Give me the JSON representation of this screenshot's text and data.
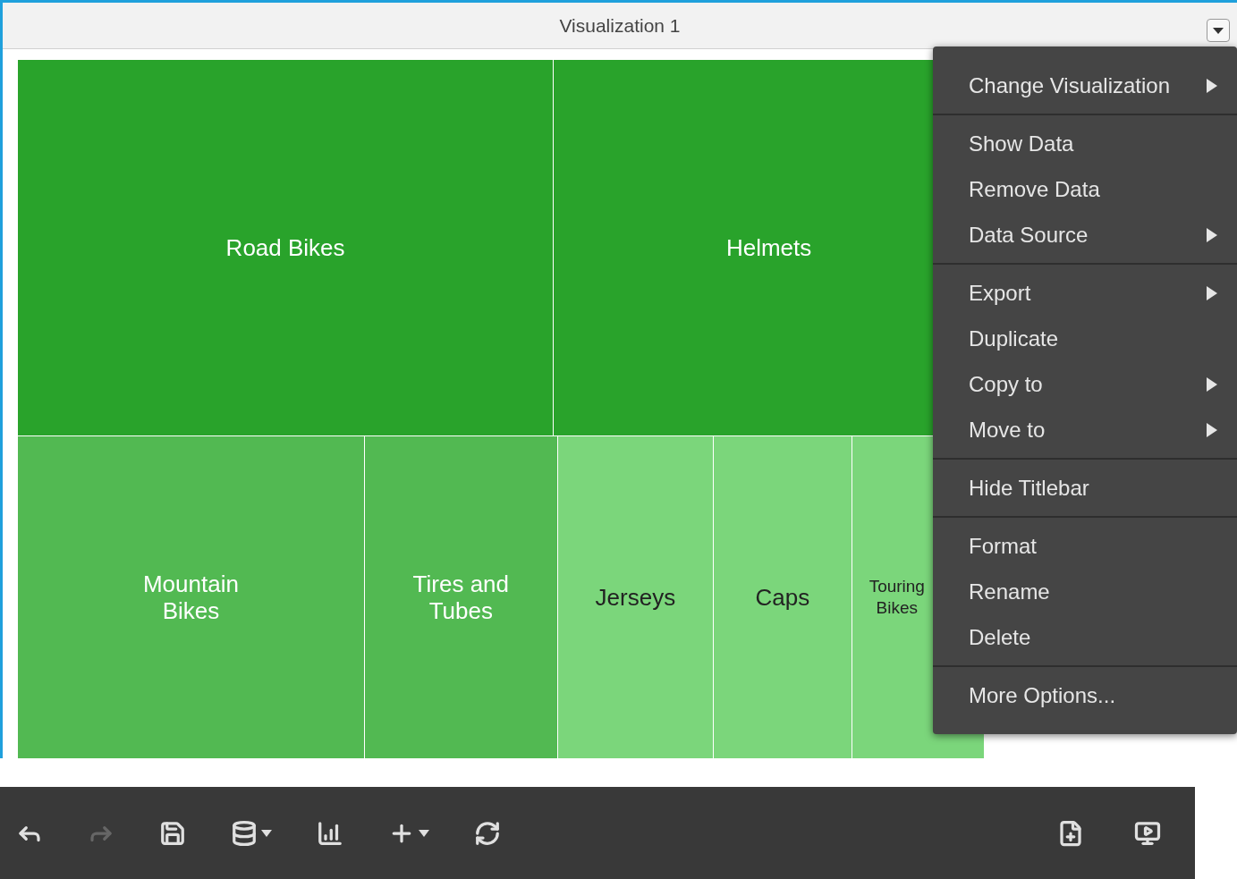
{
  "panel": {
    "title": "Visualization 1"
  },
  "treemap": {
    "cells": [
      {
        "label": "Road Bikes",
        "color": "#29a32b"
      },
      {
        "label": "Helmets",
        "color": "#29a32b"
      },
      {
        "label": "Mountain Bikes",
        "color": "#52b952"
      },
      {
        "label": "Tires and Tubes",
        "color": "#52b952"
      },
      {
        "label": "Jerseys",
        "color": "#7bd67b"
      },
      {
        "label": "Caps",
        "color": "#7bd67b"
      },
      {
        "label": "Touring Bikes",
        "color": "#7bd67b"
      }
    ]
  },
  "menu": {
    "sections": [
      [
        {
          "label": "Change Visualization",
          "submenu": true
        }
      ],
      [
        {
          "label": "Show Data",
          "submenu": false
        },
        {
          "label": "Remove Data",
          "submenu": false
        },
        {
          "label": "Data Source",
          "submenu": true
        }
      ],
      [
        {
          "label": "Export",
          "submenu": true
        },
        {
          "label": "Duplicate",
          "submenu": false
        },
        {
          "label": "Copy to",
          "submenu": true
        },
        {
          "label": "Move to",
          "submenu": true
        }
      ],
      [
        {
          "label": "Hide Titlebar",
          "submenu": false
        }
      ],
      [
        {
          "label": "Format",
          "submenu": false
        },
        {
          "label": "Rename",
          "submenu": false
        },
        {
          "label": "Delete",
          "submenu": false
        }
      ],
      [
        {
          "label": "More Options...",
          "submenu": false
        }
      ]
    ]
  },
  "toolbar": {
    "left": [
      {
        "kind": "undo",
        "disabled": false,
        "dropdown": false
      },
      {
        "kind": "redo",
        "disabled": true,
        "dropdown": false
      },
      {
        "kind": "save",
        "disabled": false,
        "dropdown": false
      },
      {
        "kind": "add-data",
        "disabled": false,
        "dropdown": true
      },
      {
        "kind": "add-chart",
        "disabled": false,
        "dropdown": false
      },
      {
        "kind": "add",
        "disabled": false,
        "dropdown": true
      },
      {
        "kind": "refresh",
        "disabled": false,
        "dropdown": false
      }
    ],
    "right": [
      {
        "kind": "new-page",
        "disabled": false,
        "dropdown": false
      },
      {
        "kind": "present",
        "disabled": false,
        "dropdown": false
      }
    ]
  }
}
